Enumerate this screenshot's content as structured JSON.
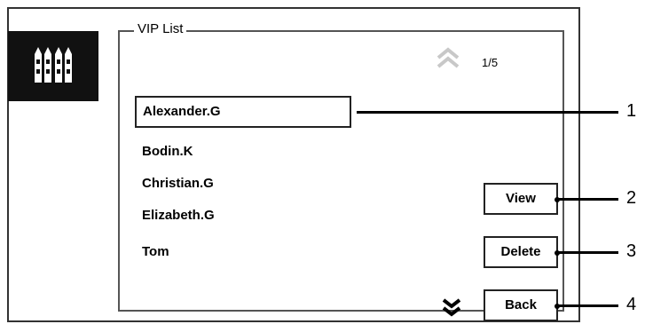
{
  "panel": {
    "title": "VIP List"
  },
  "pager": {
    "indicator": "1/5",
    "up_icon": "double-chevron-up-icon",
    "down_icon": "double-chevron-down-icon"
  },
  "side_tile": {
    "icon": "gate-icon"
  },
  "vip_list": {
    "items": [
      {
        "name": "Alexander.G",
        "selected": true
      },
      {
        "name": "Bodin.K",
        "selected": false
      },
      {
        "name": "Christian.G",
        "selected": false
      },
      {
        "name": "Elizabeth.G",
        "selected": false
      },
      {
        "name": "Tom",
        "selected": false
      }
    ]
  },
  "actions": {
    "view_label": "View",
    "delete_label": "Delete",
    "back_label": "Back"
  },
  "callouts": [
    "1",
    "2",
    "3",
    "4"
  ],
  "colors": {
    "frame": "#333333",
    "tile": "#111111",
    "page_up_icon": "#c8c8c8",
    "page_down_icon": "#000000"
  }
}
